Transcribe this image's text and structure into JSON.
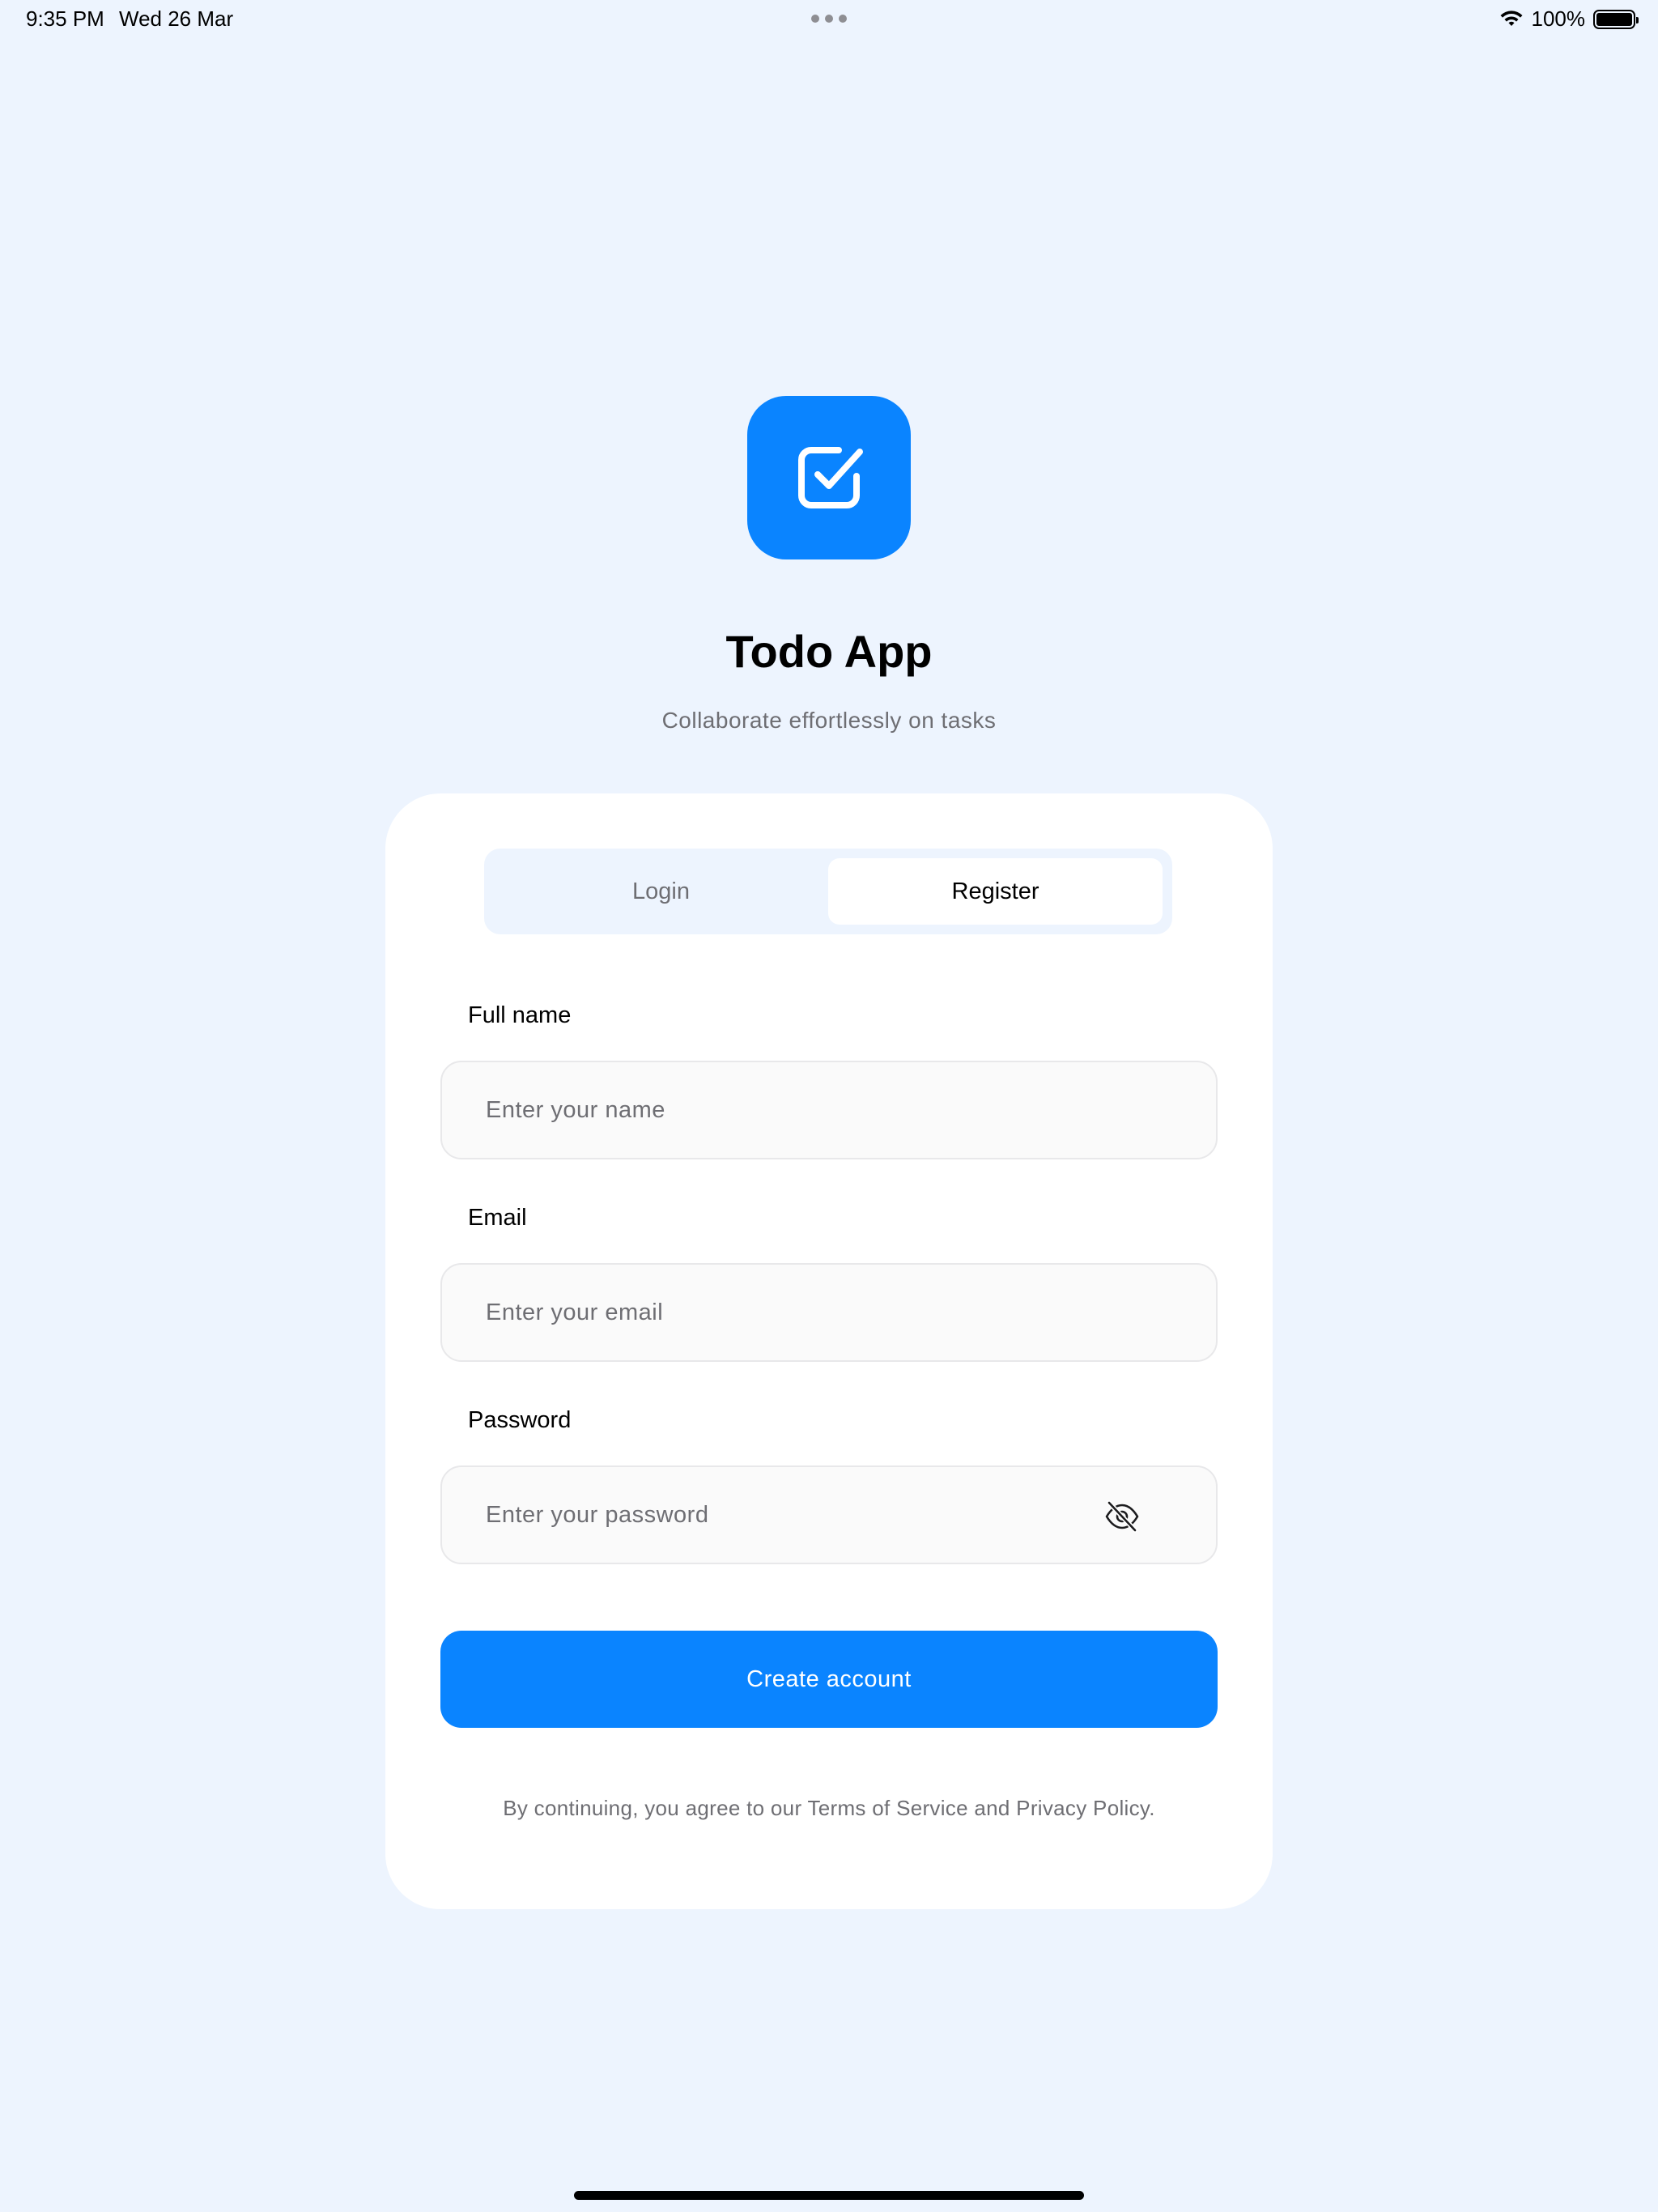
{
  "status_bar": {
    "time": "9:35 PM",
    "date": "Wed 26 Mar",
    "battery": "100%",
    "icons": [
      "wifi-icon",
      "battery-icon"
    ]
  },
  "app": {
    "logo_icon": "checkbox-icon",
    "accent_color": "#0A84FF",
    "title": "Todo App",
    "subtitle": "Collaborate effortlessly on tasks"
  },
  "auth": {
    "tabs": [
      {
        "label": "Login",
        "active": false
      },
      {
        "label": "Register",
        "active": true
      }
    ],
    "fields": {
      "name": {
        "label": "Full name",
        "placeholder": "Enter your name",
        "value": ""
      },
      "email": {
        "label": "Email",
        "placeholder": "Enter your email",
        "value": ""
      },
      "password": {
        "label": "Password",
        "placeholder": "Enter your password",
        "value": "",
        "toggle_icon": "eye-off-icon"
      }
    },
    "submit_label": "Create account",
    "terms_text": "By continuing, you agree to our Terms of Service and Privacy Policy."
  }
}
